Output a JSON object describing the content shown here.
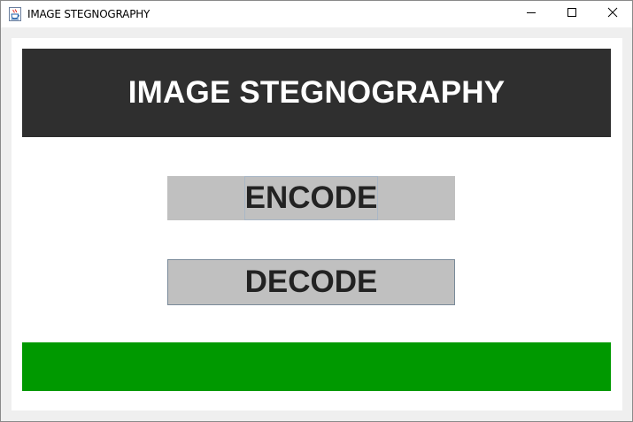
{
  "window": {
    "title": "IMAGE STEGNOGRAPHY",
    "icon": "java-cup-icon",
    "controls": {
      "minimize": "minimize-icon",
      "maximize": "maximize-icon",
      "close": "close-icon"
    }
  },
  "header": {
    "title": "IMAGE STEGNOGRAPHY",
    "background": "#2f2f2f",
    "color": "#ffffff"
  },
  "buttons": {
    "encode_label": "ENCODE",
    "decode_label": "DECODE",
    "background": "#c0c0c0"
  },
  "status_bar": {
    "color": "#009900"
  }
}
